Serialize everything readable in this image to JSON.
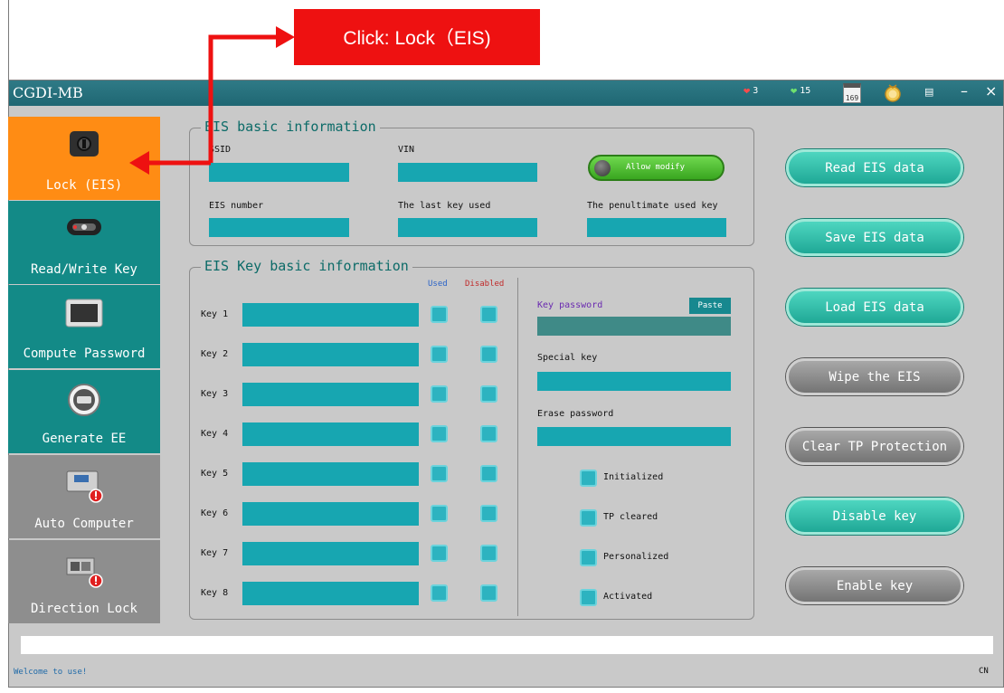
{
  "callout": {
    "text": "Click: Lock（EIS)"
  },
  "titlebar": {
    "title": "CGDI-MB",
    "red_count": "3",
    "green_count": "15",
    "calendar_day": "169",
    "menu_icon": "menu-icon",
    "minimize": "–",
    "close": "×"
  },
  "sidebar": {
    "items": [
      {
        "label": "Lock (EIS)",
        "icon": "eis-lock-icon",
        "color": "#ff8c14"
      },
      {
        "label": "Read/Write Key",
        "icon": "car-key-icon",
        "color": "#138a87"
      },
      {
        "label": "Compute Password",
        "icon": "keypad-icon",
        "color": "#138a87"
      },
      {
        "label": "Generate EE",
        "icon": "chip-icon",
        "color": "#138a87"
      },
      {
        "label": "Auto Computer",
        "icon": "ecu-icon",
        "color": "#8e8e8e"
      },
      {
        "label": "Direction Lock",
        "icon": "steering-lock-icon",
        "color": "#8e8e8e"
      }
    ]
  },
  "eis_basic": {
    "legend": "EIS basic information",
    "ssid_label": "SSID",
    "vin_label": "VIN",
    "allow_modify": "Allow modify",
    "eis_number_label": "EIS number",
    "last_key_label": "The last key used",
    "penultimate_key_label": "The penultimate used key"
  },
  "eis_key": {
    "legend": "EIS Key basic information",
    "used_header": "Used",
    "disabled_header": "Disabled",
    "keys": [
      "Key 1",
      "Key 2",
      "Key 3",
      "Key 4",
      "Key 5",
      "Key 6",
      "Key 7",
      "Key 8"
    ],
    "key_password_label": "Key password",
    "paste": "Paste",
    "special_key_label": "Special key",
    "erase_password_label": "Erase password",
    "status": [
      "Initialized",
      "TP cleared",
      "Personalized",
      "Activated"
    ]
  },
  "actions": [
    {
      "label": "Read  EIS data",
      "style": "green"
    },
    {
      "label": "Save EIS data",
      "style": "green"
    },
    {
      "label": "Load EIS data",
      "style": "green"
    },
    {
      "label": "Wipe the EIS",
      "style": "gray"
    },
    {
      "label": "Clear TP Protection",
      "style": "gray"
    },
    {
      "label": "Disable key",
      "style": "green"
    },
    {
      "label": "Enable key",
      "style": "gray"
    }
  ],
  "statusbar": {
    "message": "Welcome to use!",
    "language": "CN"
  },
  "colors": {
    "accent": "#17a6b1",
    "titlebar": "#1f6773",
    "active": "#ff8c14",
    "callout": "#ee1111"
  }
}
